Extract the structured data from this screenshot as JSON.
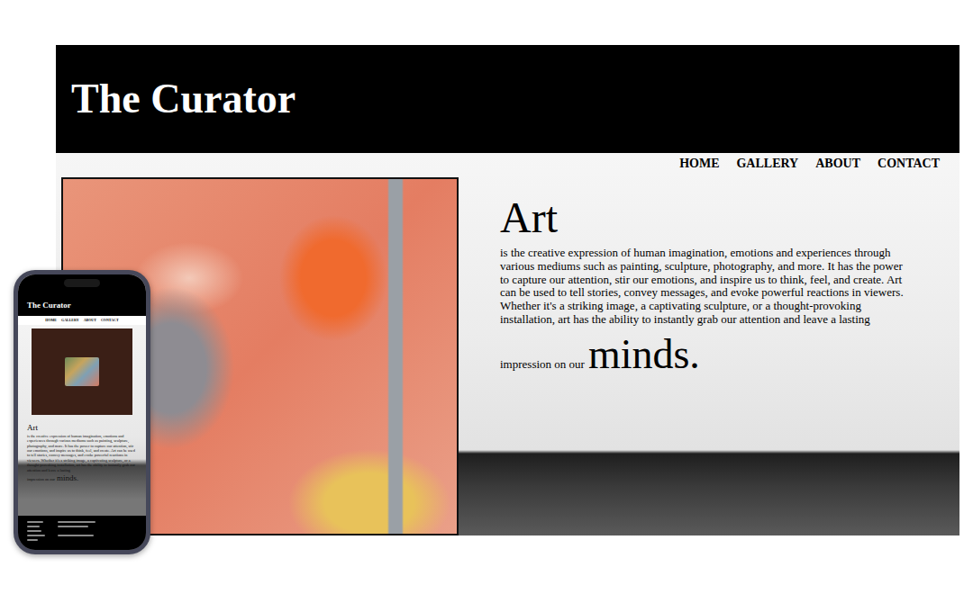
{
  "site": {
    "title": "The Curator"
  },
  "nav": [
    {
      "label": "HOME"
    },
    {
      "label": "GALLERY"
    },
    {
      "label": "ABOUT"
    },
    {
      "label": "CONTACT"
    }
  ],
  "hero": {
    "heading": "Art",
    "body": "is the creative expression of human imagination, emotions and experiences through various mediums such as painting, sculpture, photography, and more. It has the power to capture our attention, stir our emotions, and inspire us to think, feel, and create. Art can be used to tell stories, convey messages, and evoke powerful reactions in viewers. Whether it's a striking image, a captivating sculpture, or a thought-provoking installation, art has the ability to instantly grab our attention and leave a lasting",
    "closing": "impression on our",
    "emphasis": "minds."
  }
}
